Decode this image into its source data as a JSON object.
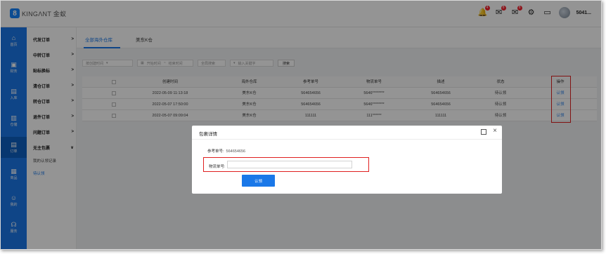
{
  "app": {
    "logo_mark": "8",
    "logo_text": "KINGΛNT 金蚁"
  },
  "topbar": {
    "icons": [
      {
        "name": "bell-icon",
        "glyph": "🔔",
        "badge": "4"
      },
      {
        "name": "message-icon",
        "glyph": "✉",
        "badge": "8"
      },
      {
        "name": "notice-icon",
        "glyph": "✉",
        "badge": "8"
      },
      {
        "name": "settings-icon",
        "glyph": "⚙",
        "badge": ""
      },
      {
        "name": "monitor-icon",
        "glyph": "▭",
        "badge": ""
      }
    ],
    "username": "5041..."
  },
  "rail": [
    {
      "label": "首页",
      "icon": "⌂"
    },
    {
      "label": "财务",
      "icon": "▣"
    },
    {
      "label": "入库",
      "icon": "▤"
    },
    {
      "label": "仓储",
      "icon": "▥"
    },
    {
      "label": "订单",
      "icon": "▤"
    },
    {
      "label": "商品",
      "icon": "▦"
    },
    {
      "label": "我的",
      "icon": "☺"
    },
    {
      "label": "服务",
      "icon": "☊"
    }
  ],
  "submenu": {
    "items": [
      {
        "label": "代发订单",
        "arrow": ">"
      },
      {
        "label": "中转订单",
        "arrow": ">"
      },
      {
        "label": "贴标换标",
        "arrow": ">"
      },
      {
        "label": "清仓订单",
        "arrow": ">"
      },
      {
        "label": "转仓订单",
        "arrow": ">"
      },
      {
        "label": "退件订单",
        "arrow": ">"
      },
      {
        "label": "问题订单",
        "arrow": ">"
      },
      {
        "label": "无主包裹",
        "arrow": "∨"
      }
    ],
    "subitems": [
      {
        "label": "我的认领记录"
      },
      {
        "label": "待认领"
      }
    ]
  },
  "tabs": [
    {
      "label": "全部海外仓库"
    },
    {
      "label": "美东K仓"
    }
  ],
  "filters": {
    "type_label": "按创建时间",
    "date_start": "开始时间",
    "date_sep": "~",
    "date_end": "结束时间",
    "search_type": "全局搜索",
    "search_placeholder": "输入关键字",
    "search_button": "搜索"
  },
  "table": {
    "headers": [
      "创建时间",
      "海外仓库",
      "参考单号",
      "物流单号",
      "描述",
      "状态",
      "操作"
    ],
    "rows": [
      {
        "created": "2022-05-09 11:13:18",
        "warehouse": "美东K仓",
        "ref": "564654656",
        "tracking": "5646********",
        "desc": "564654656",
        "status": "待认领",
        "action": "认领"
      },
      {
        "created": "2022-05-07 17:50:00",
        "warehouse": "美东K仓",
        "ref": "564654656",
        "tracking": "5646********",
        "desc": "564654656",
        "status": "待认领",
        "action": "认领"
      },
      {
        "created": "2022-05-07 09:09:04",
        "warehouse": "美东K仓",
        "ref": "111111",
        "tracking": "111******",
        "desc": "111111",
        "status": "待认领",
        "action": "认领"
      }
    ]
  },
  "modal": {
    "title": "包裹详情",
    "ref_label": "参考单号:",
    "ref_value": "564654656",
    "tracking_label": "物流单号:",
    "tracking_value": "",
    "submit_label": "认领"
  },
  "colors": {
    "accent": "#1a78e8",
    "highlight": "#e02020",
    "badge": "#f5222d"
  }
}
